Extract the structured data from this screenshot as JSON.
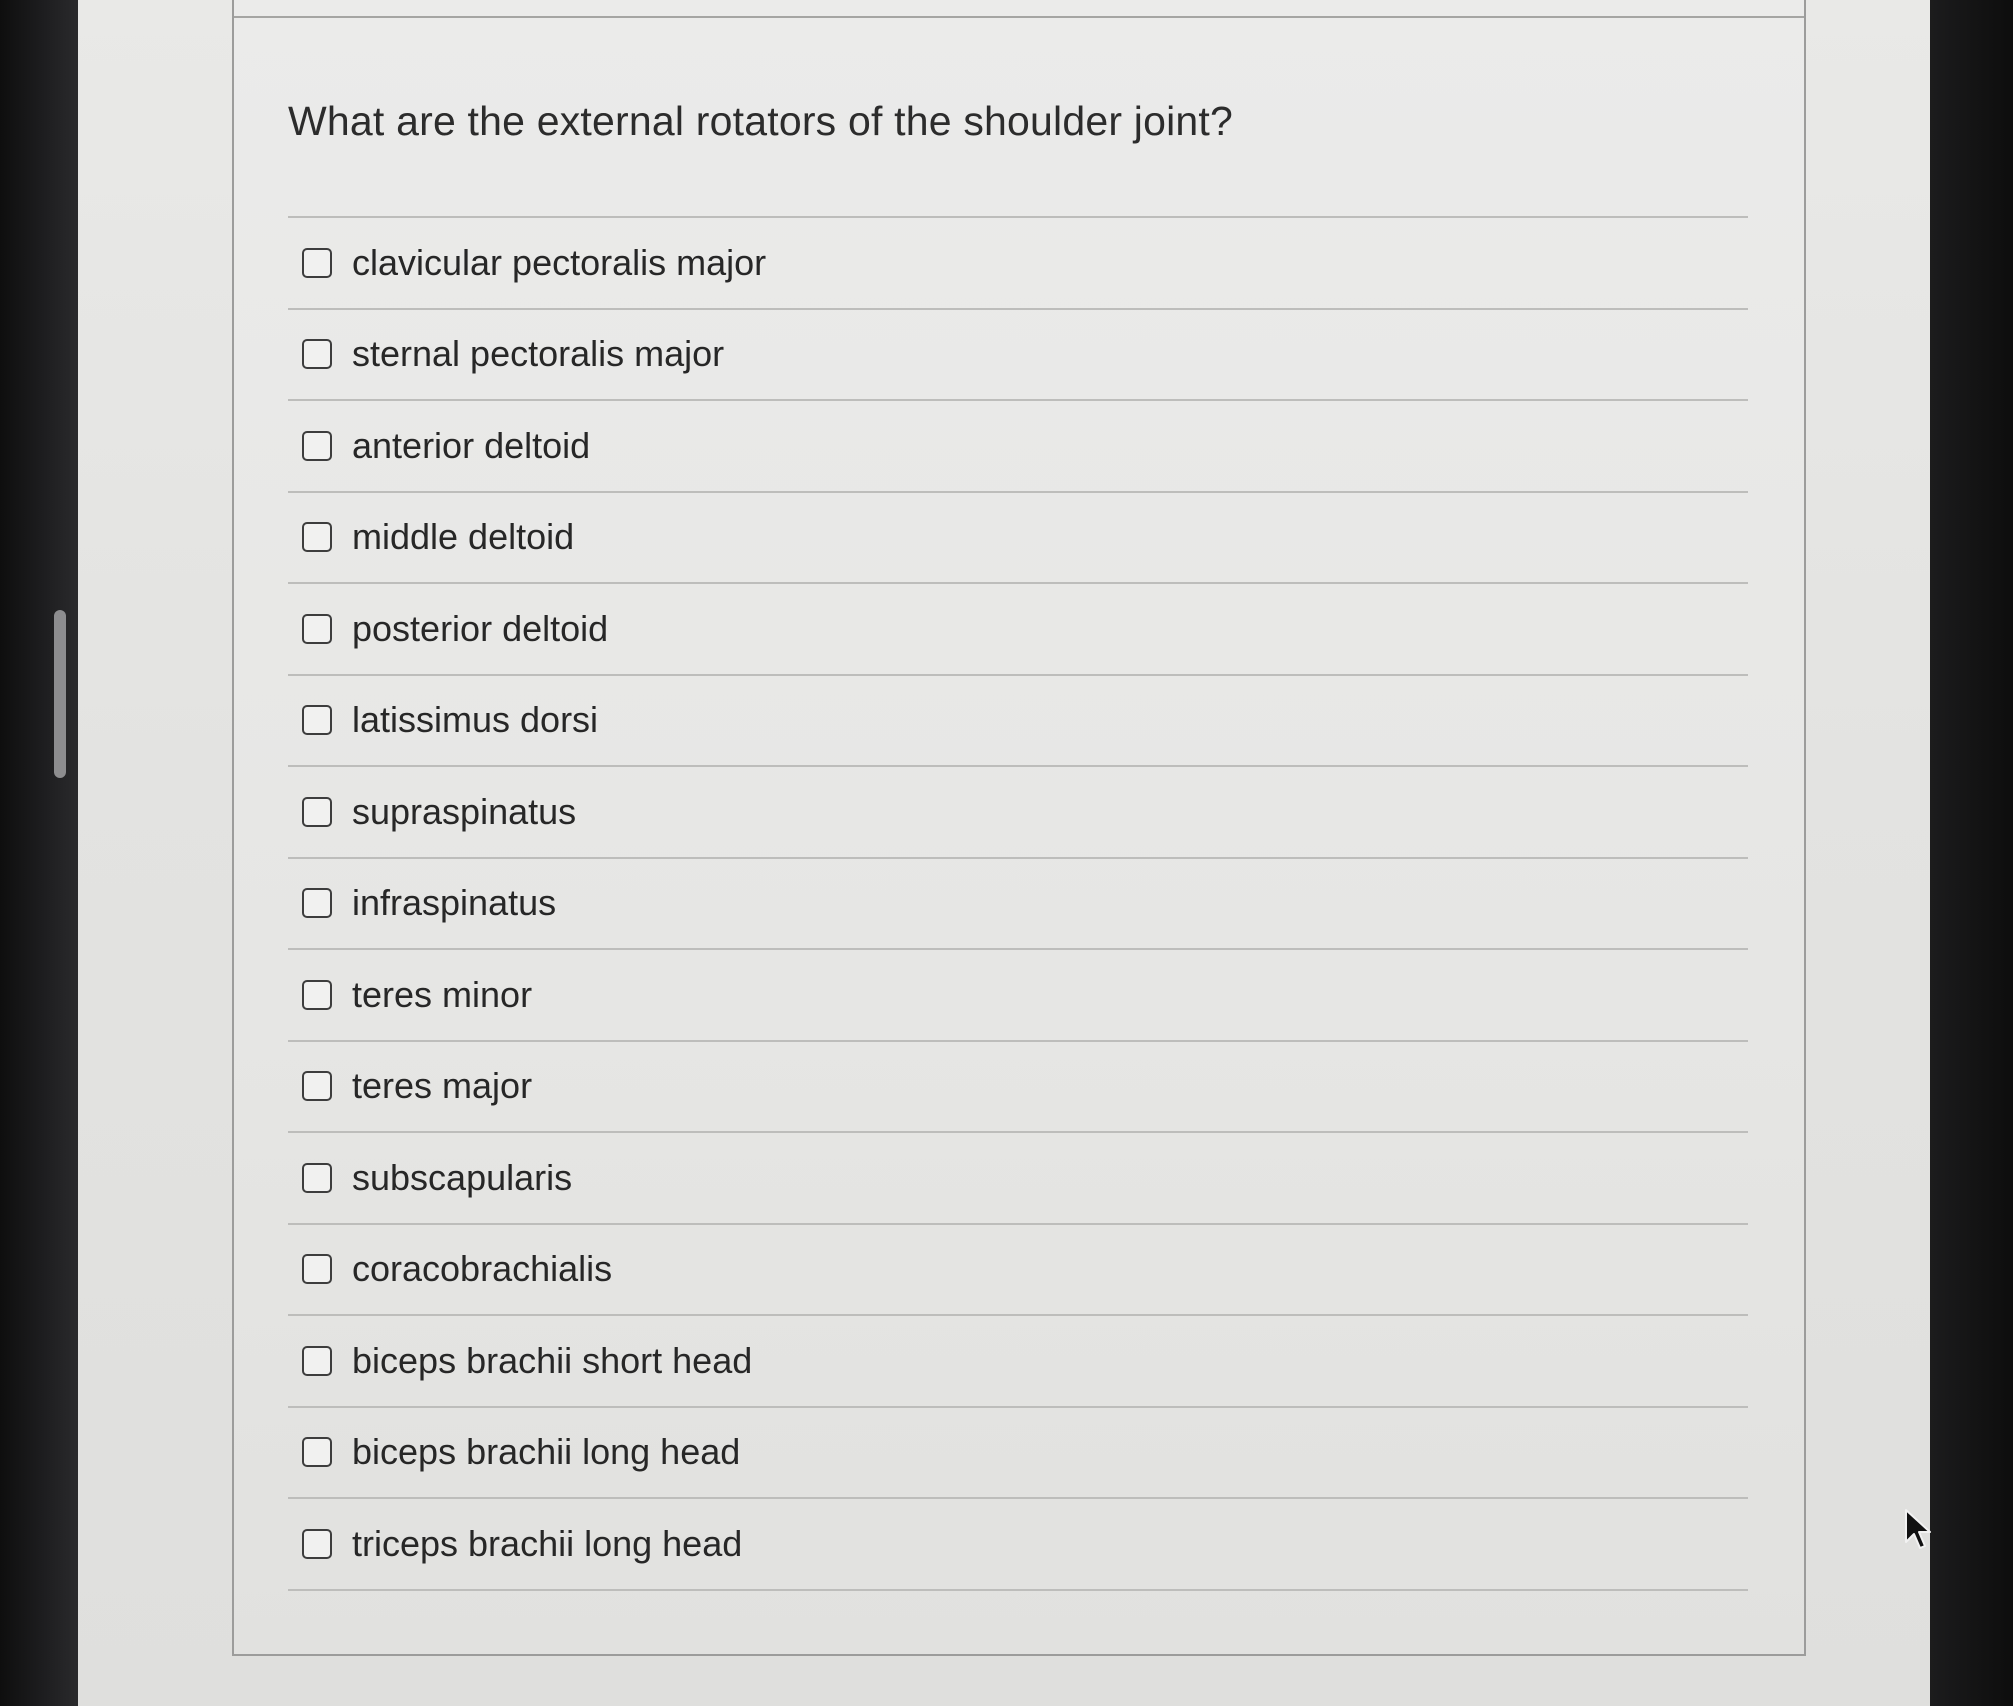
{
  "quiz": {
    "question": "What are the external rotators of the shoulder joint?",
    "options": [
      {
        "label": "clavicular pectoralis major",
        "checked": false
      },
      {
        "label": "sternal pectoralis major",
        "checked": false
      },
      {
        "label": "anterior deltoid",
        "checked": false
      },
      {
        "label": "middle deltoid",
        "checked": false
      },
      {
        "label": "posterior deltoid",
        "checked": false
      },
      {
        "label": "latissimus dorsi",
        "checked": false
      },
      {
        "label": "supraspinatus",
        "checked": false
      },
      {
        "label": "infraspinatus",
        "checked": false
      },
      {
        "label": "teres minor",
        "checked": false
      },
      {
        "label": "teres major",
        "checked": false
      },
      {
        "label": "subscapularis",
        "checked": false
      },
      {
        "label": "coracobrachialis",
        "checked": false
      },
      {
        "label": "biceps brachii short head",
        "checked": false
      },
      {
        "label": "biceps brachii long head",
        "checked": false
      },
      {
        "label": "triceps brachii long head",
        "checked": false
      }
    ]
  },
  "icons": {
    "checkbox": "checkbox-empty-icon",
    "cursor": "mouse-pointer-icon"
  },
  "colors": {
    "page_background": "#e6e6e4",
    "text": "#2c2c2c",
    "divider": "#bdbdbb",
    "card_border": "#9c9c9b"
  }
}
